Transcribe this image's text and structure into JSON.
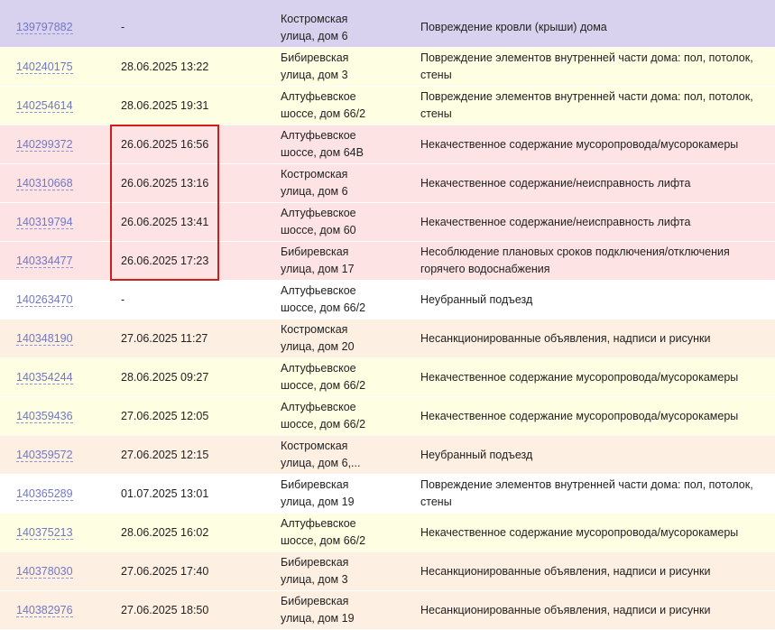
{
  "colors": {
    "lavender": "#d8d2ee",
    "yellow": "#fefee3",
    "pink": "#fde3e4",
    "white": "#ffffff",
    "peach": "#fdefe1",
    "link": "#7177c8",
    "highlight": "#d21d1d"
  },
  "rows": [
    {
      "id": "139797882",
      "date": "-",
      "address": "Костромская\nулица, дом 6",
      "description": "Повреждение кровли (крыши) дома",
      "bg": "lavender"
    },
    {
      "id": "140240175",
      "date": "28.06.2025 13:22",
      "address": "Бибиревская\nулица, дом 3",
      "description": "Повреждение элементов внутренней части дома: пол, потолок,\nстены",
      "bg": "yellow"
    },
    {
      "id": "140254614",
      "date": "28.06.2025 19:31",
      "address": "Алтуфьевское\nшоссе, дом 66/2",
      "description": "Повреждение элементов внутренней части дома: пол, потолок,\nстены",
      "bg": "yellow"
    },
    {
      "id": "140299372",
      "date": "26.06.2025 16:56",
      "address": "Алтуфьевское\nшоссе, дом 64В",
      "description": "Некачественное содержание мусоропровода/мусорокамеры",
      "bg": "pink"
    },
    {
      "id": "140310668",
      "date": "26.06.2025 13:16",
      "address": "Костромская\nулица, дом 6",
      "description": "Некачественное содержание/неисправность лифта",
      "bg": "pink"
    },
    {
      "id": "140319794",
      "date": "26.06.2025 13:41",
      "address": "Алтуфьевское\nшоссе, дом 60",
      "description": "Некачественное содержание/неисправность лифта",
      "bg": "pink"
    },
    {
      "id": "140334477",
      "date": "26.06.2025 17:23",
      "address": "Бибиревская\nулица, дом 17",
      "description": "Несоблюдение плановых сроков подключения/отключения\nгорячего водоснабжения",
      "bg": "pink"
    },
    {
      "id": "140263470",
      "date": "-",
      "address": "Алтуфьевское\nшоссе, дом 66/2",
      "description": "Неубранный подъезд",
      "bg": "white"
    },
    {
      "id": "140348190",
      "date": "27.06.2025 11:27",
      "address": "Костромская\nулица, дом 20",
      "description": "Несанкционированные объявления, надписи и рисунки",
      "bg": "peach"
    },
    {
      "id": "140354244",
      "date": "28.06.2025 09:27",
      "address": "Алтуфьевское\nшоссе, дом 66/2",
      "description": "Некачественное содержание мусоропровода/мусорокамеры",
      "bg": "yellow"
    },
    {
      "id": "140359436",
      "date": "27.06.2025 12:05",
      "address": "Алтуфьевское\nшоссе, дом 66/2",
      "description": "Некачественное содержание мусоропровода/мусорокамеры",
      "bg": "yellow"
    },
    {
      "id": "140359572",
      "date": "27.06.2025 12:15",
      "address": "Костромская\nулица, дом 6,...",
      "description": "Неубранный подъезд",
      "bg": "peach"
    },
    {
      "id": "140365289",
      "date": "01.07.2025 13:01",
      "address": "Бибиревская\nулица, дом 19",
      "description": "Повреждение элементов внутренней части дома: пол, потолок,\nстены",
      "bg": "white"
    },
    {
      "id": "140375213",
      "date": "28.06.2025 16:02",
      "address": "Алтуфьевское\nшоссе, дом 66/2",
      "description": "Некачественное содержание мусоропровода/мусорокамеры",
      "bg": "yellow"
    },
    {
      "id": "140378030",
      "date": "27.06.2025 17:40",
      "address": "Бибиревская\nулица, дом 3",
      "description": "Несанкционированные объявления, надписи и рисунки",
      "bg": "peach"
    },
    {
      "id": "140382976",
      "date": "27.06.2025 18:50",
      "address": "Бибиревская\nулица, дом 19",
      "description": "Несанкционированные объявления, надписи и рисунки",
      "bg": "peach"
    }
  ]
}
